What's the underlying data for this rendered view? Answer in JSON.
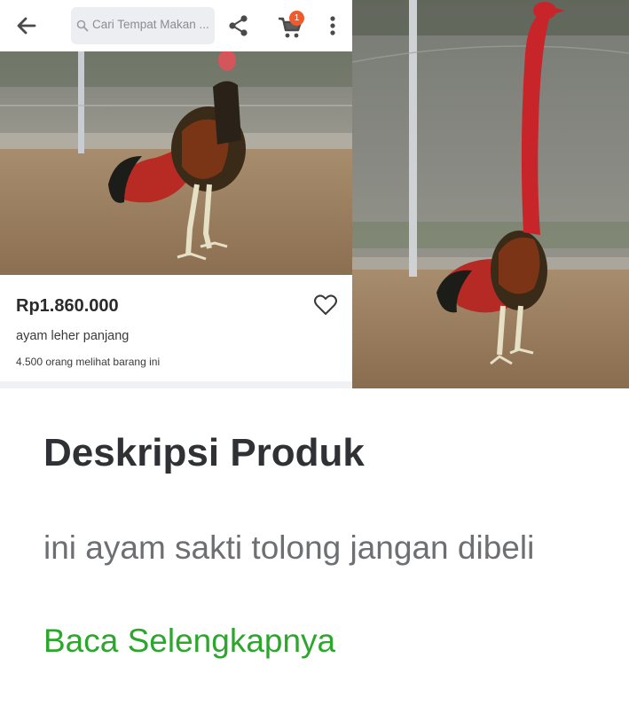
{
  "header": {
    "search_placeholder": "Cari Tempat Makan ...",
    "cart_count": "1",
    "icons": [
      "back-arrow-icon",
      "search-icon",
      "share-icon",
      "cart-icon",
      "more-vertical-icon"
    ]
  },
  "product": {
    "price": "Rp1.860.000",
    "name": "ayam leher panjang",
    "viewers": "4.500 orang melihat barang ini",
    "wishlist_icon": "heart-outline-icon"
  },
  "description": {
    "title": "Deskripsi Produk",
    "text": "ini ayam sakti tolong jangan dibeli",
    "read_more": "Baca Selengkapnya"
  },
  "colors": {
    "accent_green": "#2ba72b",
    "badge_orange": "#ef5b2a",
    "rooster_red": "#c8252b"
  }
}
